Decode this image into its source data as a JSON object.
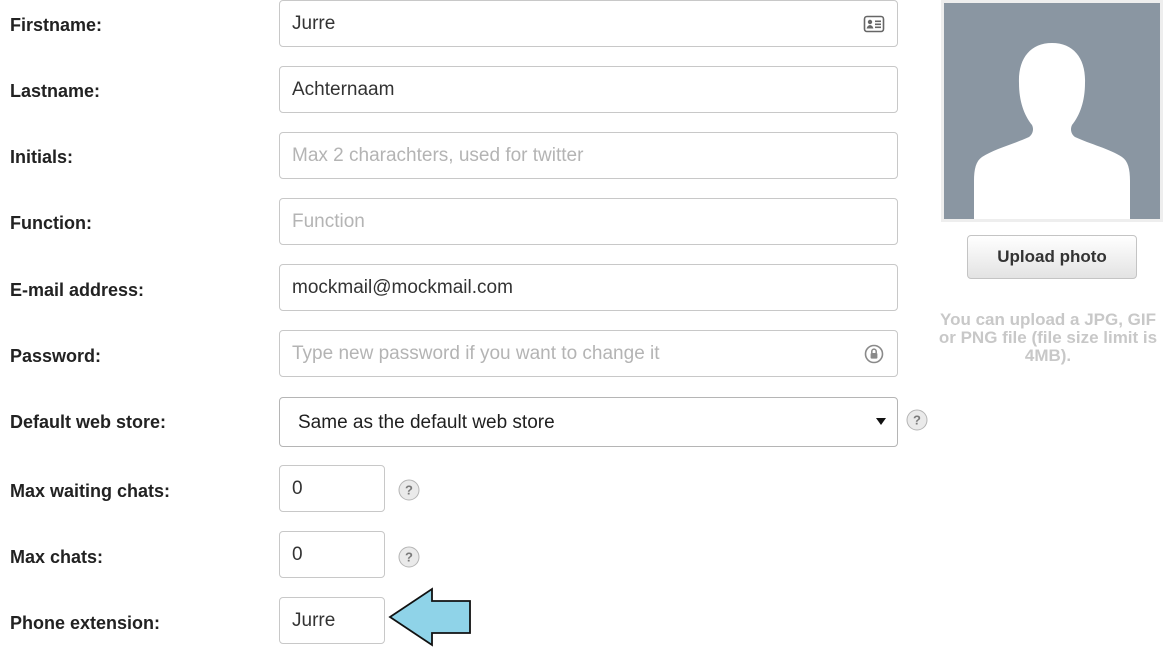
{
  "form": {
    "firstname": {
      "label": "Firstname:",
      "value": "Jurre",
      "placeholder": "",
      "icon": "contact-card-icon"
    },
    "lastname": {
      "label": "Lastname:",
      "value": "Achternaam",
      "placeholder": ""
    },
    "initials": {
      "label": "Initials:",
      "value": "",
      "placeholder": "Max 2 charachters, used for twitter"
    },
    "function": {
      "label": "Function:",
      "value": "",
      "placeholder": "Function"
    },
    "email": {
      "label": "E-mail address:",
      "value": "mockmail@mockmail.com",
      "placeholder": ""
    },
    "password": {
      "label": "Password:",
      "value": "",
      "placeholder": "Type new password if you want to change it",
      "icon": "password-reveal-icon"
    },
    "default_web_store": {
      "label": "Default web store:",
      "selected": "Same as the default web store",
      "icon": "help-icon"
    },
    "max_waiting_chats": {
      "label": "Max waiting chats:",
      "value": "0",
      "icon": "help-icon"
    },
    "max_chats": {
      "label": "Max chats:",
      "value": "0",
      "icon": "help-icon"
    },
    "phone_extension": {
      "label": "Phone extension:",
      "value": "Jurre"
    }
  },
  "photo": {
    "placeholder_icon": "person-silhouette-icon",
    "upload_label": "Upload photo",
    "note": "You can upload a JPG, GIF or PNG file (file size limit is 4MB)."
  },
  "annotation": {
    "icon": "left-arrow-icon",
    "color": "#8fd3e8"
  },
  "colors": {
    "photo_bg": "#8a96a2",
    "label_text": "#222222",
    "placeholder_text": "#b4b4b4",
    "note_text": "#c8c8c8"
  }
}
